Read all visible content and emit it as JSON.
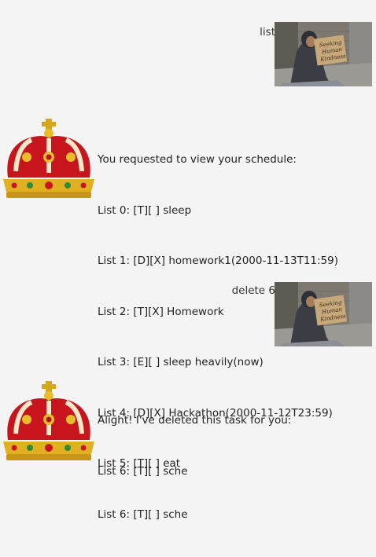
{
  "messages": [
    {
      "from": "user",
      "text": "list",
      "avatar": "homeless-person-with-cardboard-sign-photo"
    },
    {
      "from": "bot",
      "avatar": "royal-crown-icon",
      "lines": [
        "You requested to view your schedule:",
        "List 0: [T][ ] sleep",
        "List 1: [D][X] homework1(2000-11-13T11:59)",
        "List 2: [T][X] Homework",
        "List 3: [E][ ] sleep heavily(now)",
        "List 4: [D][X] Hackathon(2000-11-12T23:59)",
        "List 5: [T][ ] eat",
        "List 6: [T][ ] sche"
      ]
    },
    {
      "from": "user",
      "text": "delete 6",
      "avatar": "homeless-person-with-cardboard-sign-photo"
    },
    {
      "from": "bot",
      "avatar": "royal-crown-icon",
      "lines": [
        "Alight! I've deleted this task for you:",
        "List 6: [T][ ] sche"
      ]
    }
  ],
  "sign_text": [
    "Seeking",
    "Human",
    "Kindness"
  ]
}
